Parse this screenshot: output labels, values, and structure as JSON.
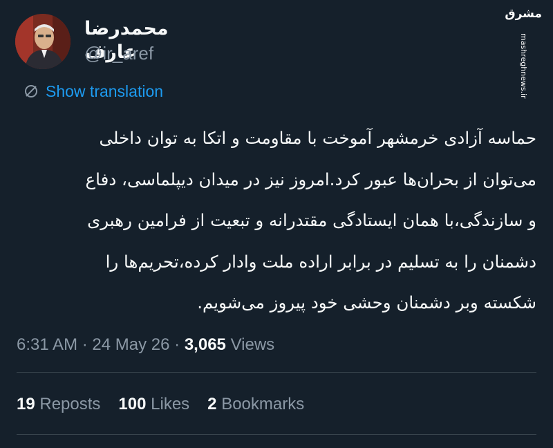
{
  "author": {
    "display_name": "محمدرضا عارف",
    "handle": "@ir_aref"
  },
  "watermark": {
    "logo_text": "مشرق",
    "url": "mashreghnews.ir"
  },
  "translate": {
    "label": "Show translation",
    "icon": "translate-off-icon"
  },
  "tweet": {
    "lines": [
      "حماسه آزادی خرمشهر آموخت با مقاومت و اتکا به توان داخلی",
      "می‌توان از بحران‌ها عبور کرد.امروز نیز در میدان دیپلماسی، دفاع",
      "و سازندگی،با همان ایستادگی مقتدرانه و تبعیت از فرامین رهبری",
      "دشمنان را به تسلیم در برابر اراده ملت وادار کرده،تحریم‌ها را",
      "شکسته وبر دشمنان وحشی خود پیروز می‌شویم."
    ]
  },
  "meta": {
    "time": "6:31 AM",
    "separator": "·",
    "date": "24 May 26",
    "views_count": "3,065",
    "views_label": "Views"
  },
  "stats": {
    "reposts_count": "19",
    "reposts_label": "Reposts",
    "likes_count": "100",
    "likes_label": "Likes",
    "bookmarks_count": "2",
    "bookmarks_label": "Bookmarks"
  },
  "colors": {
    "background": "#15202b",
    "text": "#f7f9f9",
    "secondary": "#8b98a5",
    "accent": "#1d9bf0",
    "divider": "#38444d"
  }
}
